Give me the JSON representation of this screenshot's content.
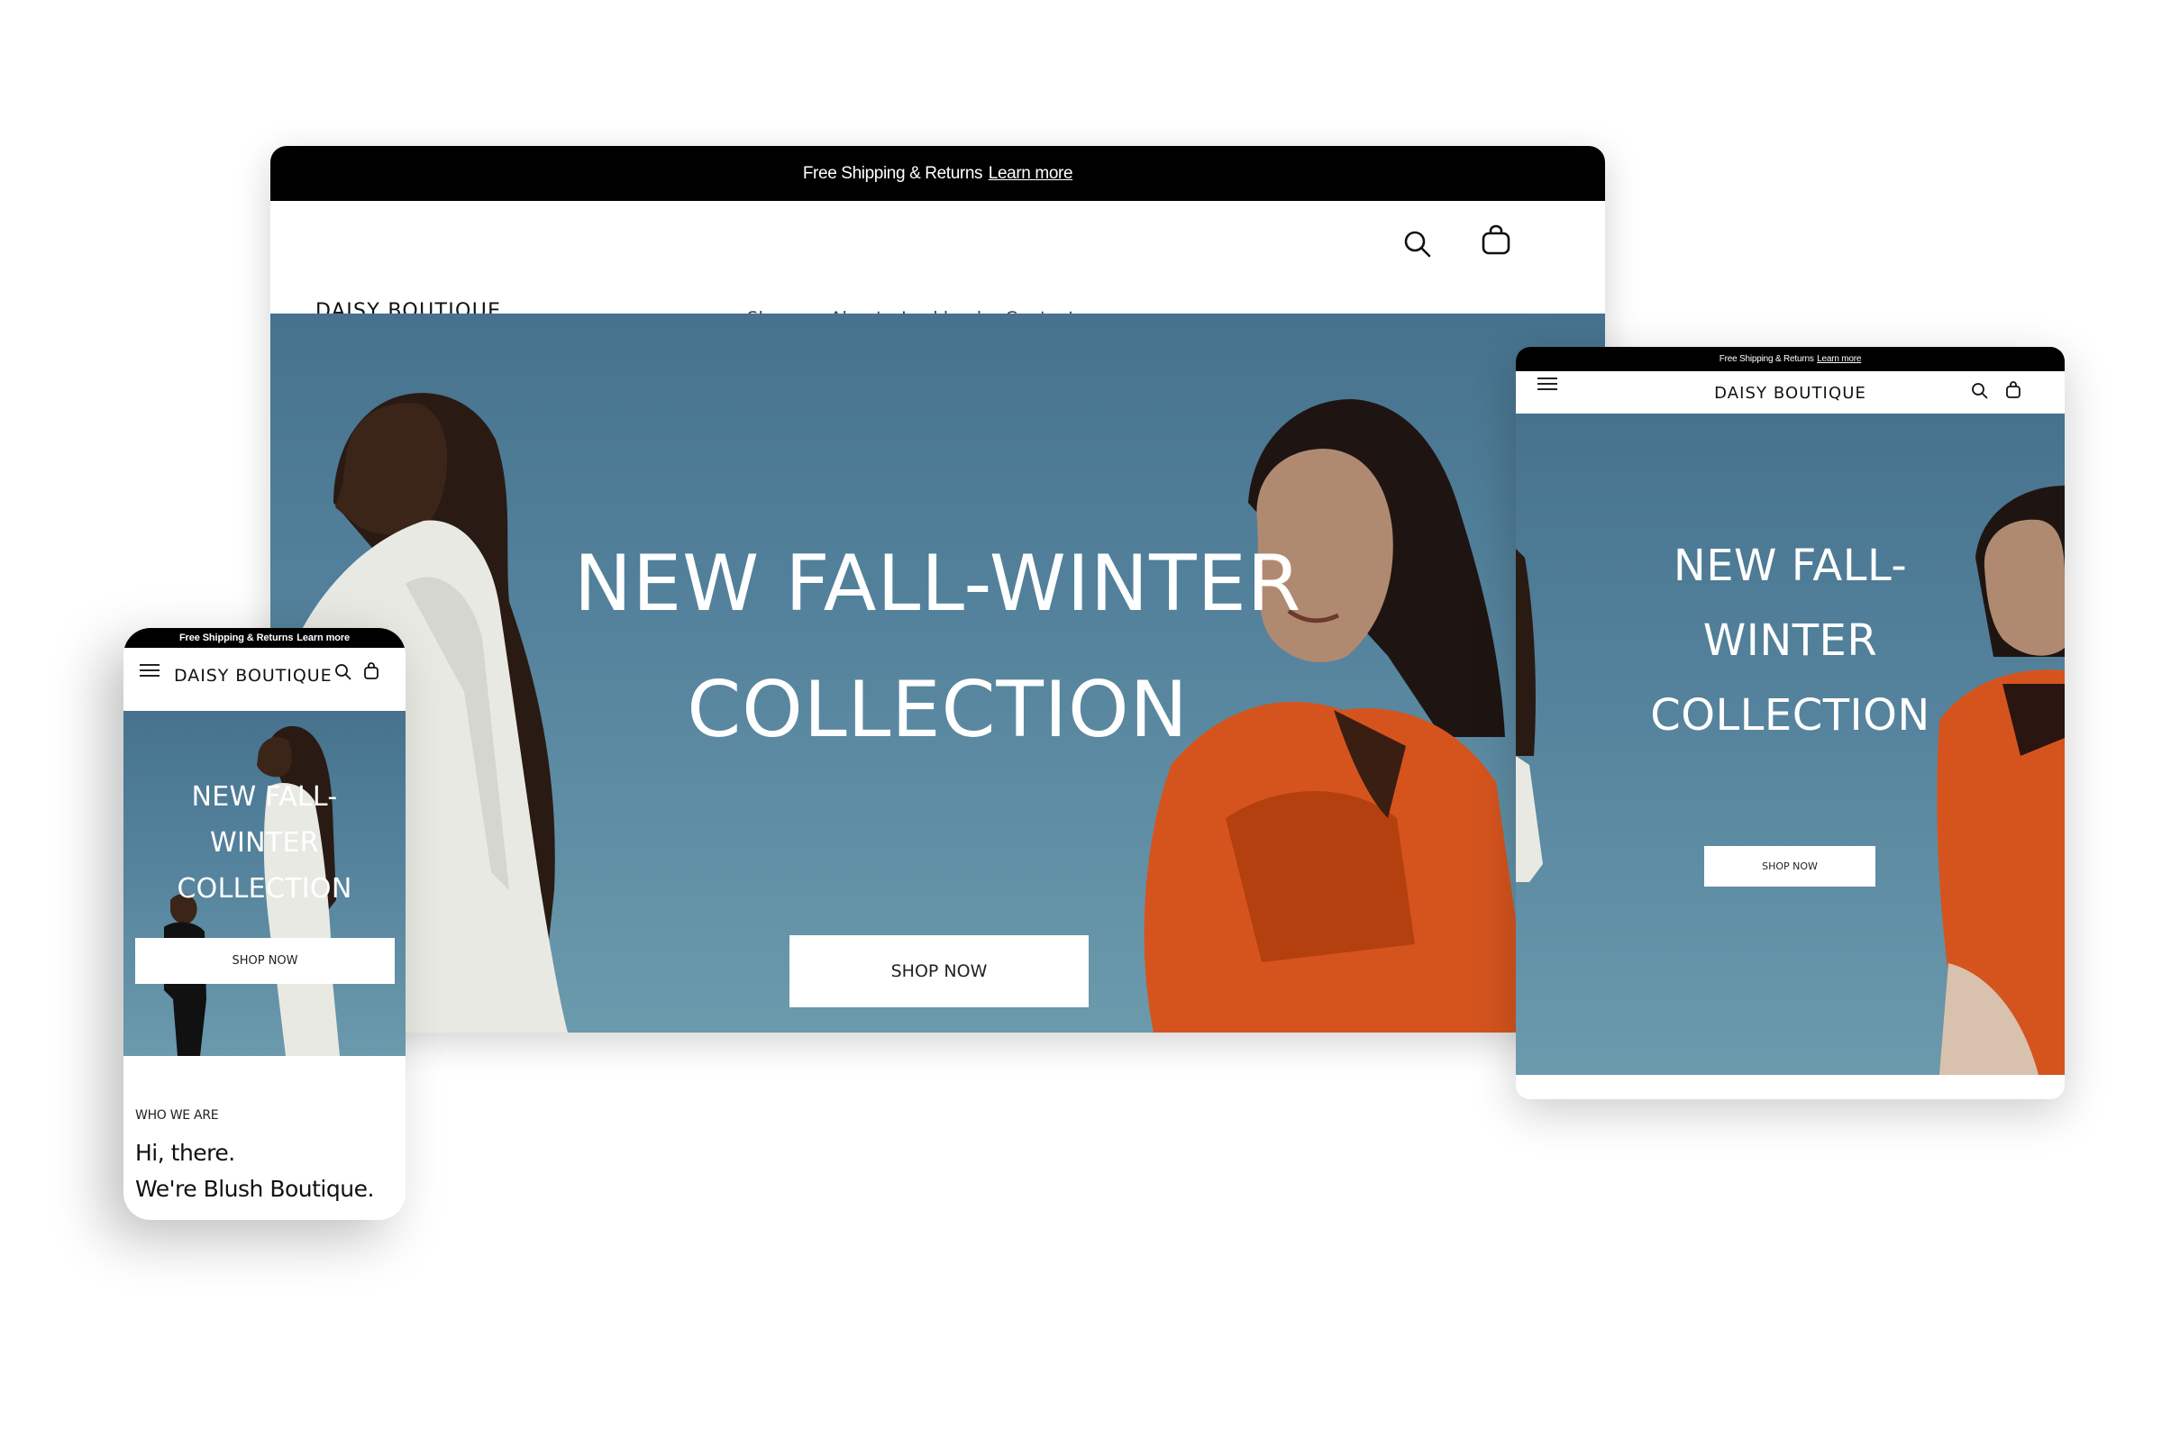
{
  "brand": {
    "name": "DAISY BOUTIQUE"
  },
  "colors": {
    "promo_bg": "#000000",
    "sky_top": "#46728d",
    "sky_bottom": "#6b9aad",
    "jacket_orange": "#d5541e",
    "white_suit": "#e8e8e2",
    "text_dark": "#111111"
  },
  "promo_bar": {
    "text": "Free Shipping & Returns",
    "link": "Learn more"
  },
  "desktop": {
    "nav": [
      {
        "label": "Shop",
        "has_dropdown": true,
        "icon": "chevron-down-icon"
      },
      {
        "label": "About"
      },
      {
        "label": "Lookbook"
      },
      {
        "label": "Contact us"
      }
    ],
    "icons": [
      "search-icon",
      "shopping-bag-icon"
    ],
    "hero": {
      "title_lines": [
        "NEW FALL-WINTER",
        "COLLECTION"
      ],
      "cta": "SHOP NOW"
    }
  },
  "tablet": {
    "icons": [
      "hamburger-menu-icon",
      "search-icon",
      "shopping-bag-icon"
    ],
    "hero": {
      "title_lines": [
        "NEW FALL-",
        "WINTER",
        "COLLECTION"
      ],
      "cta": "SHOP NOW"
    }
  },
  "phone": {
    "icons": [
      "hamburger-menu-icon",
      "search-icon",
      "shopping-bag-icon"
    ],
    "hero": {
      "title_lines": [
        "NEW FALL-",
        "WINTER",
        "COLLECTION"
      ],
      "cta": "SHOP NOW"
    },
    "about": {
      "eyebrow": "WHO WE ARE",
      "headline_lines": [
        "Hi, there.",
        "We're Blush Boutique."
      ]
    }
  }
}
